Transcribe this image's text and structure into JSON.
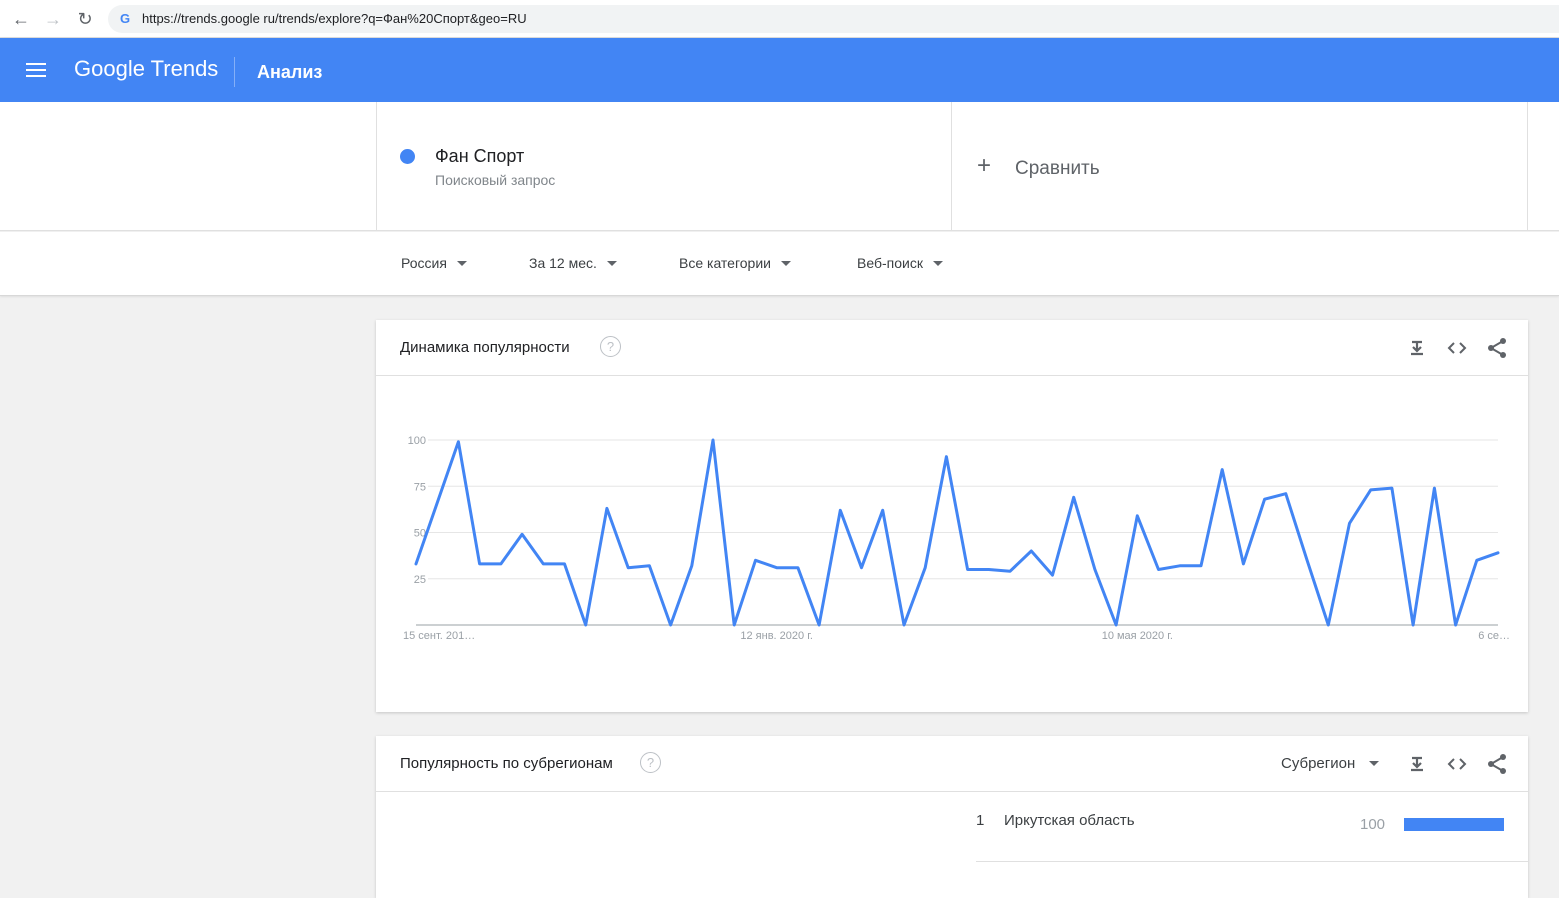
{
  "browser": {
    "url": "https://trends.google ru/trends/explore?q=Фан%20Спорт&geo=RU"
  },
  "appbar": {
    "logo": "Google Trends",
    "section": "Анализ"
  },
  "query": {
    "term": "Фан Спорт",
    "term_type": "Поисковый запрос",
    "term_color": "#4285f4",
    "compare_label": "Сравнить"
  },
  "filters": {
    "region": "Россия",
    "period": "За 12 мес.",
    "category": "Все категории",
    "search_type": "Веб-поиск"
  },
  "interest_card": {
    "title": "Динамика популярности"
  },
  "subregion_card": {
    "title": "Популярность по субрегионам",
    "resolution": "Субрегион",
    "rows": [
      {
        "rank": "1",
        "name": "Иркутская область",
        "value": "100",
        "fraction": 1.0
      }
    ]
  },
  "chart_data": {
    "type": "line",
    "series": [
      {
        "name": "Фан Спорт",
        "color": "#4285f4",
        "values": [
          33,
          66,
          99,
          33,
          33,
          49,
          33,
          33,
          0,
          63,
          31,
          32,
          0,
          32,
          100,
          0,
          35,
          31,
          31,
          0,
          62,
          31,
          62,
          0,
          31,
          91,
          30,
          30,
          29,
          40,
          27,
          69,
          30,
          0,
          59,
          30,
          32,
          32,
          84,
          33,
          68,
          71,
          35,
          0,
          55,
          73,
          74,
          0,
          74,
          0,
          35,
          39
        ]
      }
    ],
    "x_tick_labels": [
      "15 сент. 201…",
      "12 янв. 2020 г.",
      "10 мая 2020 г.",
      "6 се…"
    ],
    "x_tick_indices": [
      0,
      17,
      34,
      51
    ],
    "y_ticks": [
      25,
      50,
      75,
      100
    ],
    "ylim": [
      0,
      100
    ],
    "grid": true
  }
}
